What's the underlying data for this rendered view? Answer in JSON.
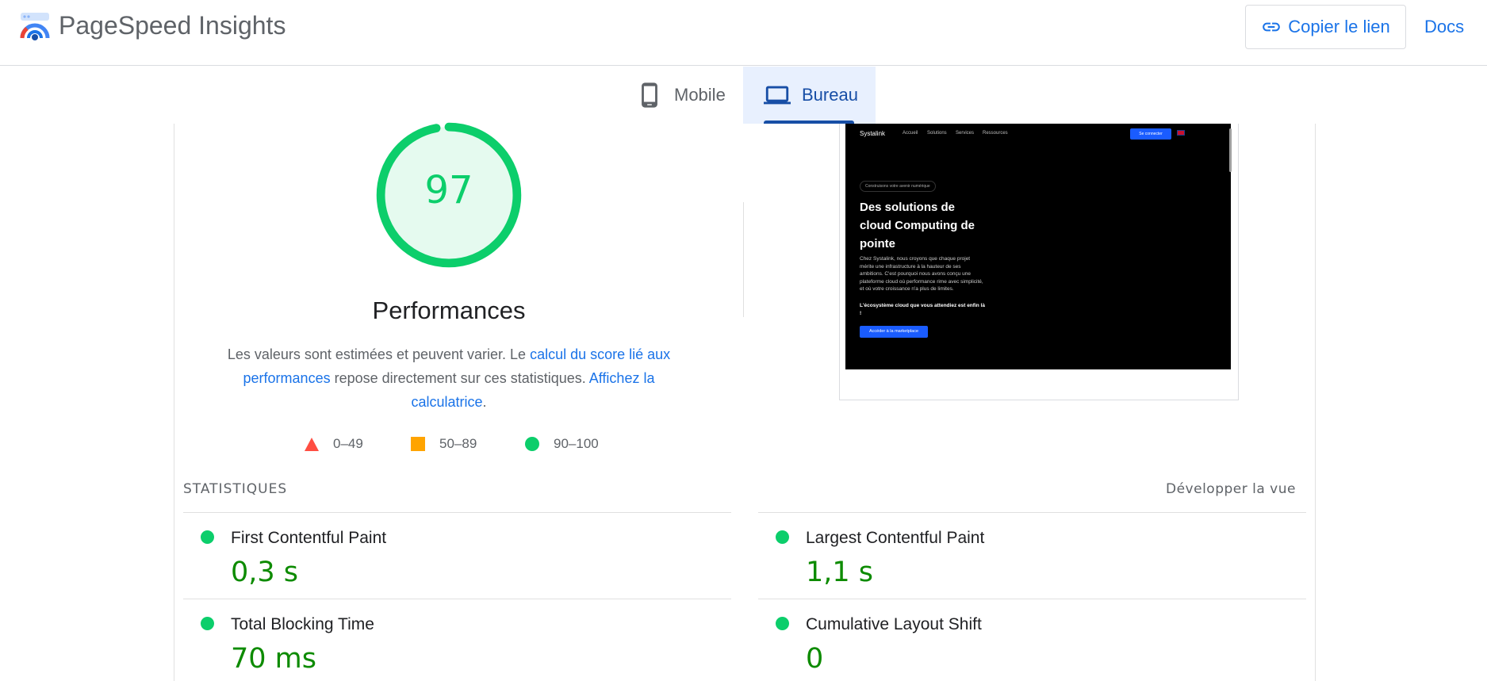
{
  "header": {
    "app_title": "PageSpeed Insights",
    "copy_link_label": "Copier le lien",
    "docs_label": "Docs"
  },
  "tabs": [
    {
      "label": "Mobile",
      "icon": "smartphone-icon",
      "selected": false
    },
    {
      "label": "Bureau",
      "icon": "laptop-icon",
      "selected": true
    }
  ],
  "performance": {
    "score": "97",
    "score_fraction": 0.97,
    "title": "Performances",
    "desc_text_1": "Les valeurs sont estimées et peuvent varier. Le ",
    "desc_link_1": "calcul du score lié aux performances",
    "desc_text_2": " repose directement sur ces statistiques. ",
    "desc_link_2": "Affichez la calculatrice",
    "desc_text_3": "."
  },
  "legend": [
    {
      "range": "0–49",
      "shape": "triangle",
      "color": "#ff4e42"
    },
    {
      "range": "50–89",
      "shape": "square",
      "color": "#ffa400"
    },
    {
      "range": "90–100",
      "shape": "circle",
      "color": "#0cce6b"
    }
  ],
  "preview": {
    "site_logo": "Systalink",
    "nav": [
      "Accueil",
      "Solutions",
      "Services",
      "Ressources"
    ],
    "login_button": "Se connecter",
    "pill": "Construisons votre avenir numérique",
    "heading": "Des solutions de cloud Computing de pointe",
    "body": "Chez Systalink, nous croyons que chaque projet mérite une infrastructure à la hauteur de ses ambitions. C'est pourquoi nous avons conçu une plateforme cloud où performance rime avec simplicité, et où votre croissance n'a plus de limites.",
    "strong": "L'écosystème cloud que vous attendiez est enfin là !",
    "cta": "Accéder à la marketplace"
  },
  "stats": {
    "title": "STATISTIQUES",
    "expand_label": "Développer la vue",
    "metrics": [
      {
        "label": "First Contentful Paint",
        "value": "0,3 s",
        "status": "good"
      },
      {
        "label": "Largest Contentful Paint",
        "value": "1,1 s",
        "status": "good"
      },
      {
        "label": "Total Blocking Time",
        "value": "70 ms",
        "status": "good"
      },
      {
        "label": "Cumulative Layout Shift",
        "value": "0",
        "status": "good"
      }
    ]
  },
  "colors": {
    "good": "#0cce6b",
    "good_text": "#0d8b00",
    "average": "#ffa400",
    "poor": "#ff4e42",
    "link": "#1a73e8",
    "selected_tab_bg": "#e8f0fe",
    "selected_tab_text": "#174ea6"
  }
}
